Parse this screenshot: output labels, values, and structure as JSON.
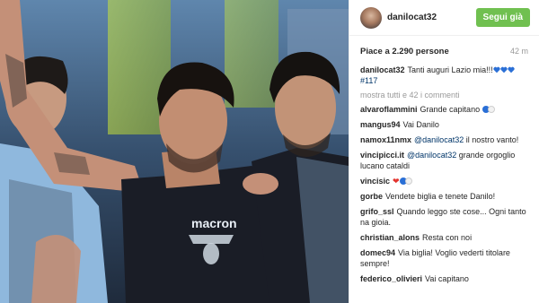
{
  "header": {
    "username": "danilocat32",
    "follow_label": "Segui già"
  },
  "meta": {
    "likes": "Piace a 2.290 persone",
    "time": "42 m"
  },
  "caption": {
    "user": "danilocat32",
    "text": "Tanti auguri Lazio mia!!!",
    "hashtag": "#117"
  },
  "load_more": "mostra tutti e 42 i commenti",
  "comments": [
    {
      "user": "alvaroflammini",
      "text": "Grande capitano",
      "emoji": "blue-white-ball"
    },
    {
      "user": "mangus94",
      "text": "Vai Danilo"
    },
    {
      "user": "namox11nmx",
      "mention": "@danilocat32",
      "text": "il nostro vanto!"
    },
    {
      "user": "vincipicci.it",
      "mention": "@danilocat32",
      "text": "grande orgoglio lucano cataldi"
    },
    {
      "user": "vincisic",
      "text": "",
      "emoji": "heart-balls"
    },
    {
      "user": "gorbe",
      "text": "Vendete biglia e tenete Danilo!"
    },
    {
      "user": "grifo_ssl",
      "text": "Quando leggo ste cose... Ogni tanto na gioia."
    },
    {
      "user": "christian_alons",
      "text": "Resta con noi"
    },
    {
      "user": "domec94",
      "text": "Via biglia! Voglio vederti titolare sempre!"
    },
    {
      "user": "federico_olivieri",
      "text": "Vai capitano"
    }
  ],
  "photo": {
    "shirt_brand": "macron"
  },
  "colors": {
    "follow_green": "#70c050",
    "heart_blue": "#2a6fd6",
    "jersey_dark": "#1a1d26",
    "jersey_light": "#8fb8dd"
  }
}
